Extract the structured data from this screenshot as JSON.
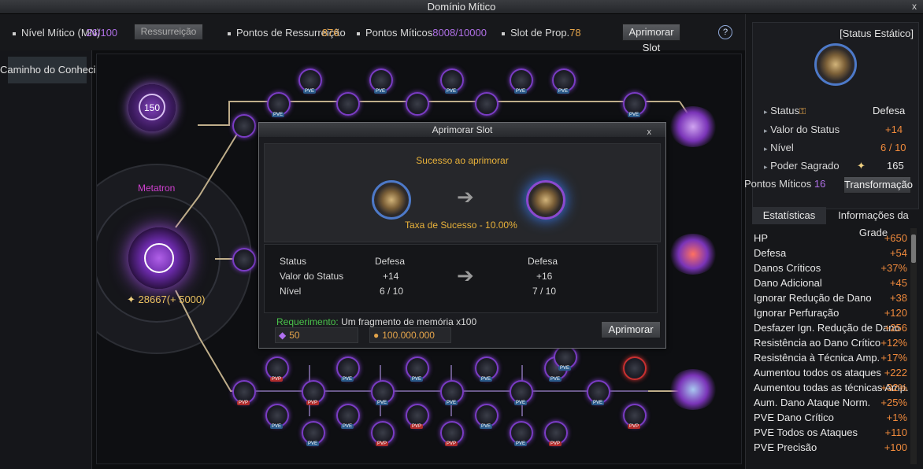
{
  "window": {
    "title": "Domínio Mítico",
    "close": "x"
  },
  "topbar": {
    "mythic_level_label": "Nível Mítico (MN)",
    "mythic_level_value": "26/100",
    "resurrection_button": "Ressurreição",
    "resurrection_points_label": "Pontos de Ressurreição",
    "resurrection_points_value": "876",
    "mythic_points_label": "Pontos Míticos",
    "mythic_points_value": "8008/10000",
    "prop_slot_label": "Slot de Prop.",
    "prop_slot_value": "78",
    "upgrade_slot_button": "Aprimorar Slot",
    "help": "?"
  },
  "left_panel": {
    "tab_label": "Caminho do Conhecimento"
  },
  "tree": {
    "level_badge": "150",
    "character_name": "Metatron",
    "power_value": "28667",
    "power_bonus": "(+ 5000)",
    "node_tags": {
      "pve": "PVE",
      "pvp": "PVP"
    }
  },
  "dialog": {
    "title": "Aprimorar Slot",
    "close": "x",
    "success_title": "Sucesso ao aprimorar",
    "success_rate": "Taxa de Sucesso - 10.00%",
    "table": {
      "labels": [
        "Status",
        "Valor do Status",
        "Nível"
      ],
      "current": [
        "Defesa",
        "+14",
        "6 / 10"
      ],
      "next": [
        "Defesa",
        "+16",
        "7 / 10"
      ]
    },
    "requirement_label": "Requerimento:",
    "requirement_value": "Um fragmento de memória x100",
    "gem_cost": "50",
    "gold_cost": "100.000.000",
    "confirm_button": "Aprimorar"
  },
  "right_panel": {
    "header": "[Status Estático]",
    "status_label": "Status",
    "status_value": "Defesa",
    "value_label": "Valor do Status",
    "value_value": "+14",
    "level_label": "Nível",
    "level_value": "6 / 10",
    "sacred_label": "Poder Sagrado",
    "sacred_value": "165",
    "mythic_points_label": "Pontos Míticos",
    "mythic_points_value": "16",
    "transform_button": "Transformação",
    "tab_stats": "Estatísticas",
    "tab_grid": "Informações da Grade",
    "stats": [
      {
        "name": "HP",
        "value": "+650"
      },
      {
        "name": "Defesa",
        "value": "+54"
      },
      {
        "name": "Danos Críticos",
        "value": "+37%"
      },
      {
        "name": "Dano Adicional",
        "value": "+45"
      },
      {
        "name": "Ignorar Redução de Dano",
        "value": "+38"
      },
      {
        "name": "Ignorar Perfuração",
        "value": "+120"
      },
      {
        "name": "Desfazer Ign. Redução de Dano",
        "value": "+256"
      },
      {
        "name": "Resistência ao Dano Crítico",
        "value": "+12%"
      },
      {
        "name": "Resistência à Técnica Amp.",
        "value": "+17%"
      },
      {
        "name": "Aumentou todos os ataques",
        "value": "+222"
      },
      {
        "name": "Aumentou todas as técnicas Amp.",
        "value": "+32%"
      },
      {
        "name": "Aum. Dano Ataque Norm.",
        "value": "+25%"
      },
      {
        "name": "PVE Dano Crítico",
        "value": "+1%"
      },
      {
        "name": "PVE Todos os Ataques",
        "value": "+110"
      },
      {
        "name": "PVE Precisão",
        "value": "+100"
      }
    ]
  }
}
